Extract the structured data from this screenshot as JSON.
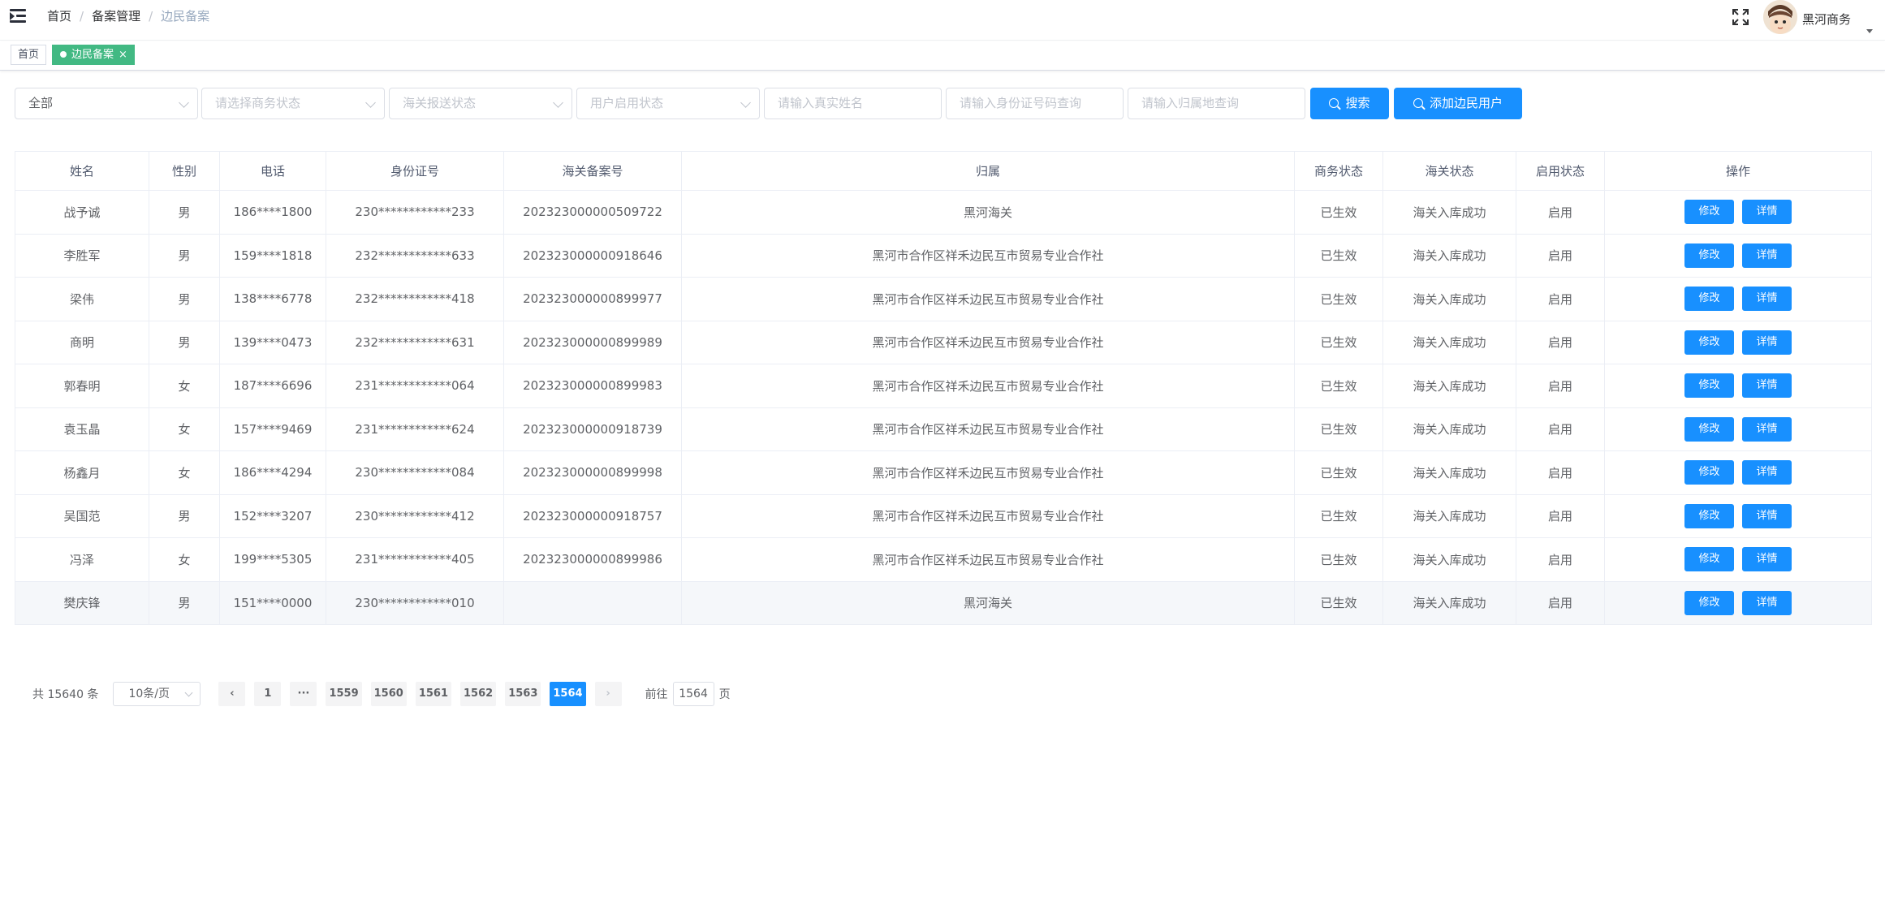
{
  "navbar": {
    "breadcrumb": [
      "首页",
      "备案管理",
      "边民备案"
    ],
    "username": "黑河商务"
  },
  "tags": {
    "home": "首页",
    "active": "边民备案",
    "close_glyph": "×"
  },
  "filters": {
    "scope": "全部",
    "business_status_placeholder": "请选择商务状态",
    "customs_status_placeholder": "海关报送状态",
    "enable_status_placeholder": "用户启用状态",
    "name_placeholder": "请输入真实姓名",
    "idcard_placeholder": "请输入身份证号码查询",
    "region_placeholder": "请输入归属地查询",
    "search_label": "搜索",
    "add_label": "添加边民用户"
  },
  "table": {
    "columns": [
      "姓名",
      "性别",
      "电话",
      "身份证号",
      "海关备案号",
      "归属",
      "商务状态",
      "海关状态",
      "启用状态",
      "操作"
    ],
    "edit_label": "修改",
    "detail_label": "详情",
    "rows": [
      [
        "战予诚",
        "男",
        "186****1800",
        "230************233",
        "202323000000509722",
        "黑河海关",
        "已生效",
        "海关入库成功",
        "启用"
      ],
      [
        "李胜军",
        "男",
        "159****1818",
        "232************633",
        "202323000000918646",
        "黑河市合作区祥禾边民互市贸易专业合作社",
        "已生效",
        "海关入库成功",
        "启用"
      ],
      [
        "梁伟",
        "男",
        "138****6778",
        "232************418",
        "202323000000899977",
        "黑河市合作区祥禾边民互市贸易专业合作社",
        "已生效",
        "海关入库成功",
        "启用"
      ],
      [
        "商明",
        "男",
        "139****0473",
        "232************631",
        "202323000000899989",
        "黑河市合作区祥禾边民互市贸易专业合作社",
        "已生效",
        "海关入库成功",
        "启用"
      ],
      [
        "郭春明",
        "女",
        "187****6696",
        "231************064",
        "202323000000899983",
        "黑河市合作区祥禾边民互市贸易专业合作社",
        "已生效",
        "海关入库成功",
        "启用"
      ],
      [
        "袁玉晶",
        "女",
        "157****9469",
        "231************624",
        "202323000000918739",
        "黑河市合作区祥禾边民互市贸易专业合作社",
        "已生效",
        "海关入库成功",
        "启用"
      ],
      [
        "杨鑫月",
        "女",
        "186****4294",
        "230************084",
        "202323000000899998",
        "黑河市合作区祥禾边民互市贸易专业合作社",
        "已生效",
        "海关入库成功",
        "启用"
      ],
      [
        "吴国范",
        "男",
        "152****3207",
        "230************412",
        "202323000000918757",
        "黑河市合作区祥禾边民互市贸易专业合作社",
        "已生效",
        "海关入库成功",
        "启用"
      ],
      [
        "冯泽",
        "女",
        "199****5305",
        "231************405",
        "202323000000899986",
        "黑河市合作区祥禾边民互市贸易专业合作社",
        "已生效",
        "海关入库成功",
        "启用"
      ],
      [
        "樊庆锋",
        "男",
        "151****0000",
        "230************010",
        "",
        "黑河海关",
        "已生效",
        "海关入库成功",
        "启用"
      ]
    ]
  },
  "pagination": {
    "total_text": "共 15640 条",
    "page_size": "10条/页",
    "prev_glyph": "‹",
    "next_glyph": "›",
    "pages": [
      "1",
      "···",
      "1559",
      "1560",
      "1561",
      "1562",
      "1563",
      "1564"
    ],
    "current": "1564",
    "jump_prefix": "前往",
    "jump_value": "1564",
    "jump_suffix": "页"
  },
  "colors": {
    "primary": "#1890ff",
    "tag_active": "#42b983"
  }
}
